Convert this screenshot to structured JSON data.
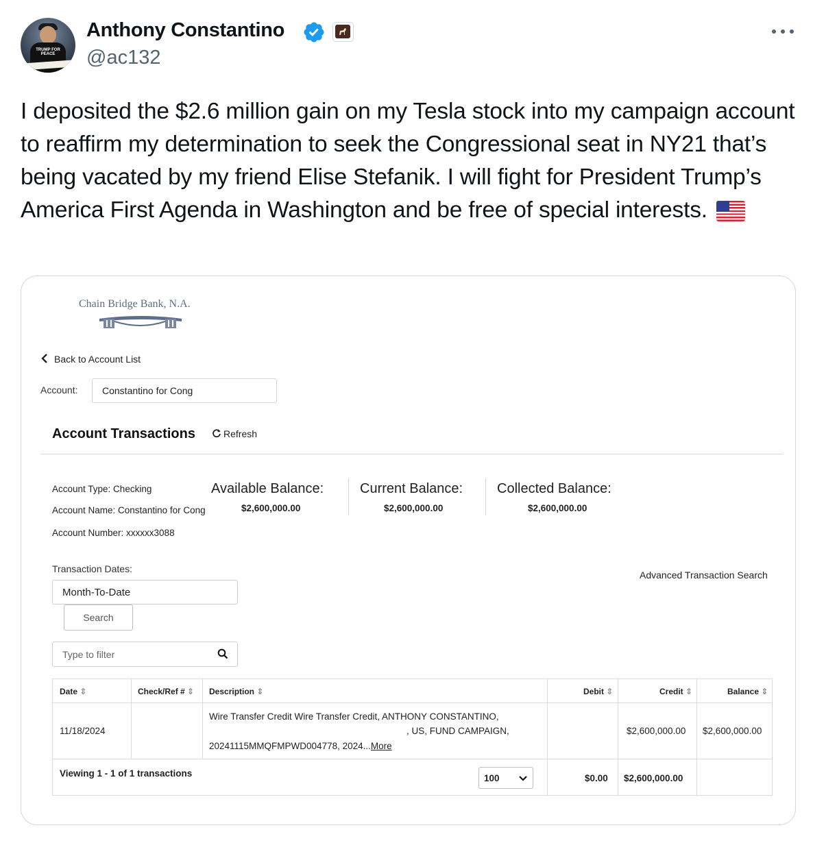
{
  "tweet": {
    "author_name": "Anthony Constantino",
    "handle": "@ac132",
    "text": "I deposited the $2.6 million gain on my Tesla stock into my campaign account to reaffirm my determination to seek the Congressional seat in NY21 that’s being vacated by my friend Elise Stefanik. I will fight for President Trump’s America First Agenda in Washington and be free of special interests.",
    "avatar_text": "TRUMP FOR PEACE",
    "icons": {
      "verified": "verified-badge-icon",
      "affiliate": "affiliate-badge-icon",
      "more": "more-options-icon",
      "flag": "us-flag-emoji"
    },
    "colors": {
      "verified": "#1d9bf0",
      "handle": "#536471",
      "border": "#cfd9de"
    }
  },
  "bank": {
    "logo_text": "Chain Bridge Bank, N.A.",
    "back_label": "Back to Account List",
    "account_label": "Account:",
    "account_value": "Constantino for Cong",
    "section_title": "Account Transactions",
    "refresh_label": "Refresh",
    "info": {
      "type": "Account Type: Checking",
      "name": "Account Name: Constantino for Cong",
      "number": "Account Number: xxxxxx3088"
    },
    "balances": [
      {
        "label": "Available Balance:",
        "value": "$2,600,000.00"
      },
      {
        "label": "Current Balance:",
        "value": "$2,600,000.00"
      },
      {
        "label": "Collected Balance:",
        "value": "$2,600,000.00"
      }
    ],
    "dates_label": "Transaction Dates:",
    "dates_value": "Month-To-Date",
    "search_label": "Search",
    "advanced_search": "Advanced Transaction Search",
    "filter_placeholder": "Type to filter",
    "table": {
      "headers": [
        "Date",
        "Check/Ref #",
        "Description",
        "Debit",
        "Credit",
        "Balance"
      ],
      "row": {
        "date": "11/18/2024",
        "check_ref": "",
        "desc_line1": "Wire Transfer Credit Wire Transfer Credit, ANTHONY CONSTANTINO,",
        "desc_line2": ", US, FUND CAMPAIGN,",
        "desc_line3": "20241115MMQFMPWD004778, 2024...",
        "desc_more": "More",
        "debit": "",
        "credit": "$2,600,000.00",
        "balance": "$2,600,000.00"
      },
      "footer": {
        "viewing": "Viewing 1 - 1 of 1 transactions",
        "page_size": "100",
        "debit_total": "$0.00",
        "credit_total": "$2,600,000.00"
      }
    }
  }
}
